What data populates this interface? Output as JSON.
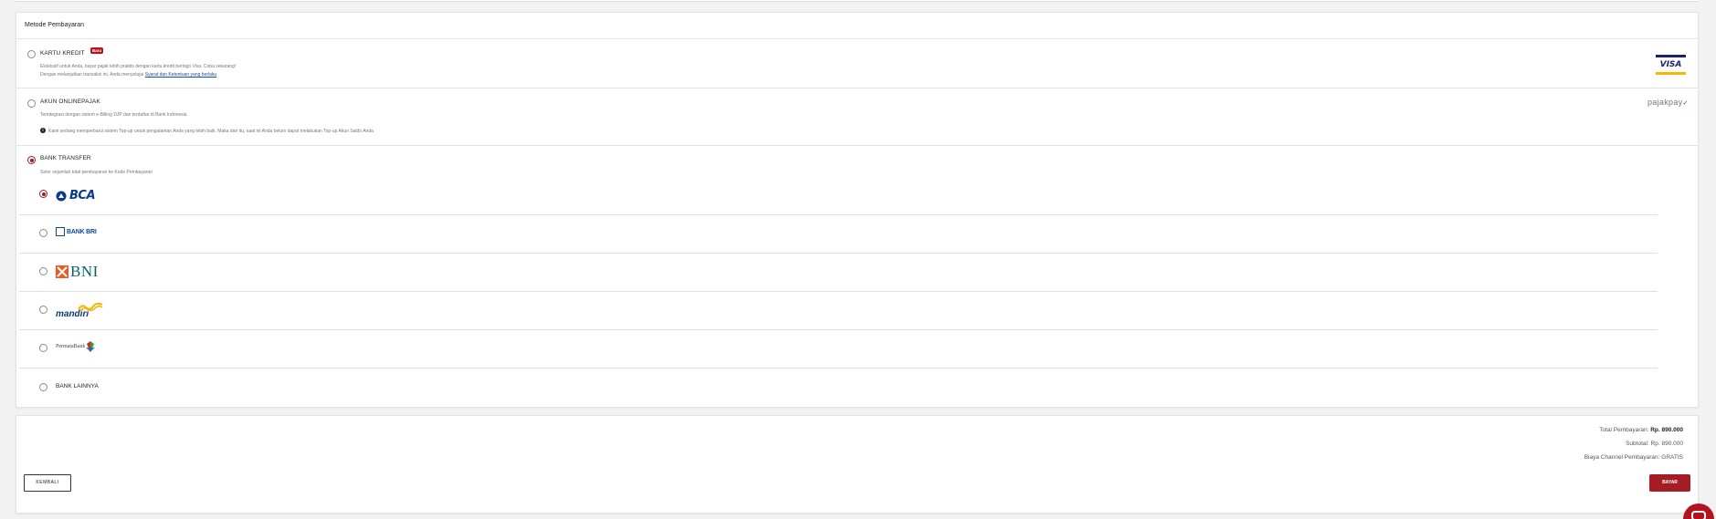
{
  "title": "Metode Pembayaran",
  "methods": {
    "credit_card": {
      "label": "KARTU KREDIT",
      "badge": "Baru",
      "desc": "Eksklusif untuk Anda, bayar pajak lebih praktis dengan kartu kredit berlogo Visa. Coba sekarang!",
      "terms_prefix": "Dengan melanjutkan transaksi ini, Anda menyetujui ",
      "terms_link": "Syarat dan Ketentuan yang berlaku",
      "logo_text": "VISA"
    },
    "onlinepajak": {
      "label": "AKUN ONLINEPAJAK",
      "desc": "Terintegrasi dengan sistem e-Billing DJP dan terdaftar di Bank Indonesia",
      "info": "Kami sedang memperbarui sistem Top-up untuk pengalaman Anda yang lebih baik. Maka dari itu, saat ini Anda belum dapat melakukan Top-up Akun Saldo Anda",
      "logo_text": "pajakpay"
    },
    "bank_transfer": {
      "label": "BANK TRANSFER",
      "desc": "Setor sejumlah total pembayaran ke Kode Pembayaran",
      "banks": [
        {
          "logo_text": "BCA",
          "selected": true
        },
        {
          "logo_text": "BANK BRI",
          "selected": false
        },
        {
          "logo_text": "BNI",
          "selected": false
        },
        {
          "logo_text": "mandiri",
          "selected": false
        },
        {
          "logo_text": "PermataBank",
          "selected": false
        },
        {
          "label": "BANK LAINNYA",
          "selected": false
        }
      ]
    }
  },
  "summary": {
    "total_label": "Total Pembayaran:",
    "total_value": "Rp. 890.000",
    "subtotal_label": "Subtotal:",
    "subtotal_value": "Rp. 890.000",
    "channel_label": "Biaya Channel Pembayaran:",
    "channel_value": "GRATIS"
  },
  "buttons": {
    "back": "KEMBALI",
    "pay": "BAYAR"
  },
  "colors": {
    "accent": "#a51c24",
    "link": "#1a4aa8"
  }
}
